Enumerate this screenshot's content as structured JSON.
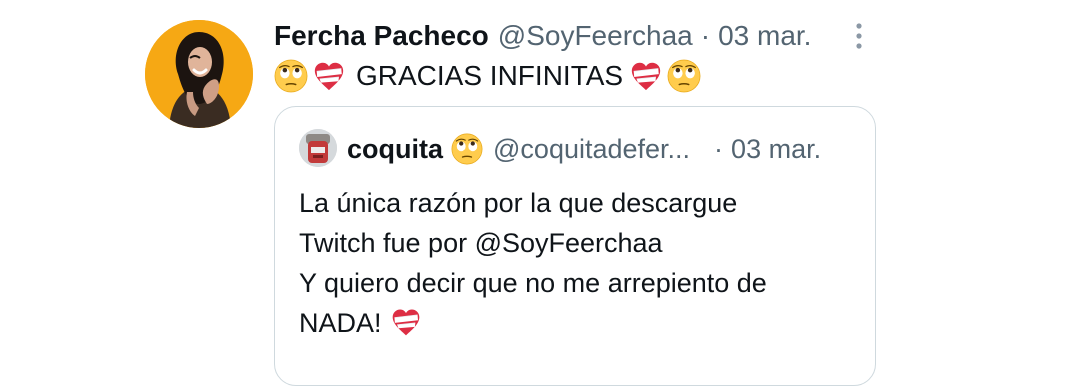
{
  "tweet": {
    "author_name": "Fercha Pacheco",
    "author_handle": "@SoyFeerchaa",
    "separator": "·",
    "date": "03 mar.",
    "text": "GRACIAS INFINITAS",
    "leading_emojis": [
      "face-with-rolling-eyes",
      "mending-heart"
    ],
    "trailing_emojis": [
      "mending-heart",
      "face-with-rolling-eyes"
    ]
  },
  "quote": {
    "author_name": "coquita",
    "author_name_emoji": "face-with-rolling-eyes",
    "author_handle": "@coquitadefer...",
    "separator": "·",
    "date": "03 mar.",
    "lines": [
      "La única razón por la que descargue",
      "Twitch fue por @SoyFeerchaa",
      "Y quiero decir que no me arrepiento de",
      "NADA!"
    ],
    "trailing_emoji": "mending-heart"
  },
  "colors": {
    "primary_text": "#0f1419",
    "secondary_text": "#536471",
    "border": "#cfd9de",
    "avatar_background": "#f6a814"
  },
  "icons": {
    "more": "more-vertical-icon"
  }
}
